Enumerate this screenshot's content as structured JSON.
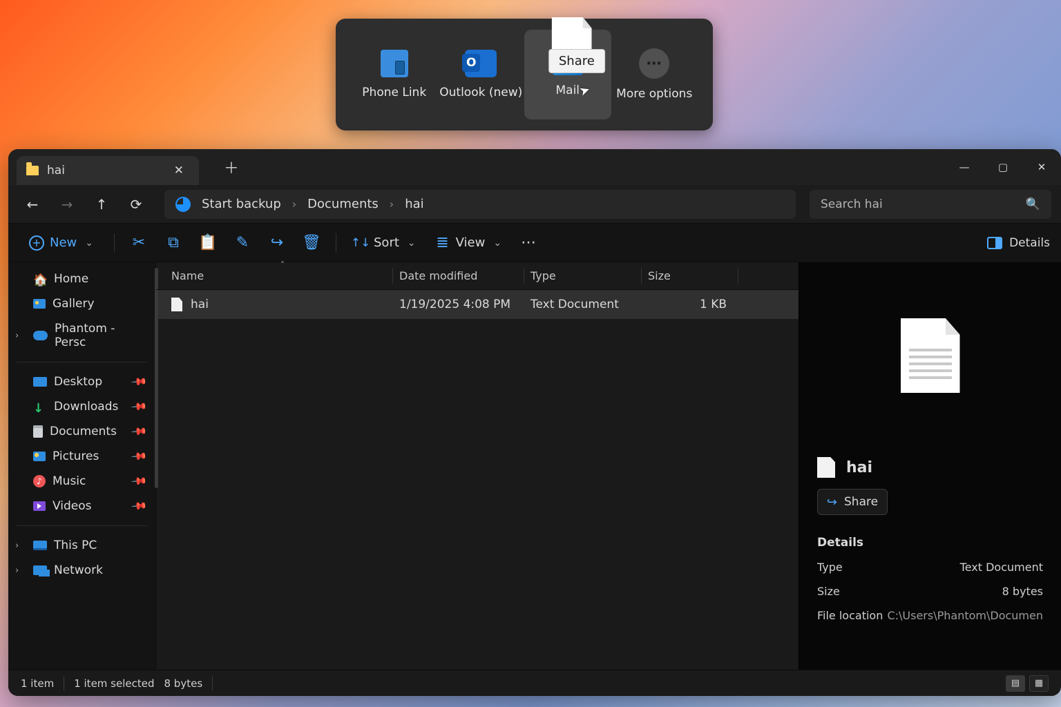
{
  "share_popup": {
    "items": [
      {
        "label": "Phone Link"
      },
      {
        "label": "Outlook (new)"
      },
      {
        "label": "Mail"
      },
      {
        "label": "More options"
      }
    ],
    "tooltip": "Share"
  },
  "window": {
    "tab_title": "hai"
  },
  "breadcrumbs": {
    "start_backup": "Start backup",
    "documents": "Documents",
    "current": "hai"
  },
  "search": {
    "placeholder": "Search hai"
  },
  "toolbar": {
    "new_label": "New",
    "sort_label": "Sort",
    "view_label": "View",
    "details_label": "Details"
  },
  "sidebar": {
    "home": "Home",
    "gallery": "Gallery",
    "phantom": "Phantom - Persc",
    "desktop": "Desktop",
    "downloads": "Downloads",
    "documents": "Documents",
    "pictures": "Pictures",
    "music": "Music",
    "videos": "Videos",
    "this_pc": "This PC",
    "network": "Network"
  },
  "columns": {
    "name": "Name",
    "date": "Date modified",
    "type": "Type",
    "size": "Size"
  },
  "files": [
    {
      "name": "hai",
      "date": "1/19/2025 4:08 PM",
      "type": "Text Document",
      "size": "1 KB"
    }
  ],
  "details": {
    "filename": "hai",
    "share_label": "Share",
    "heading": "Details",
    "type_label": "Type",
    "type_value": "Text Document",
    "size_label": "Size",
    "size_value": "8 bytes",
    "location_label": "File location",
    "location_value": "C:\\Users\\Phantom\\Documen"
  },
  "status": {
    "count": "1 item",
    "selected": "1 item selected",
    "bytes": "8 bytes"
  }
}
